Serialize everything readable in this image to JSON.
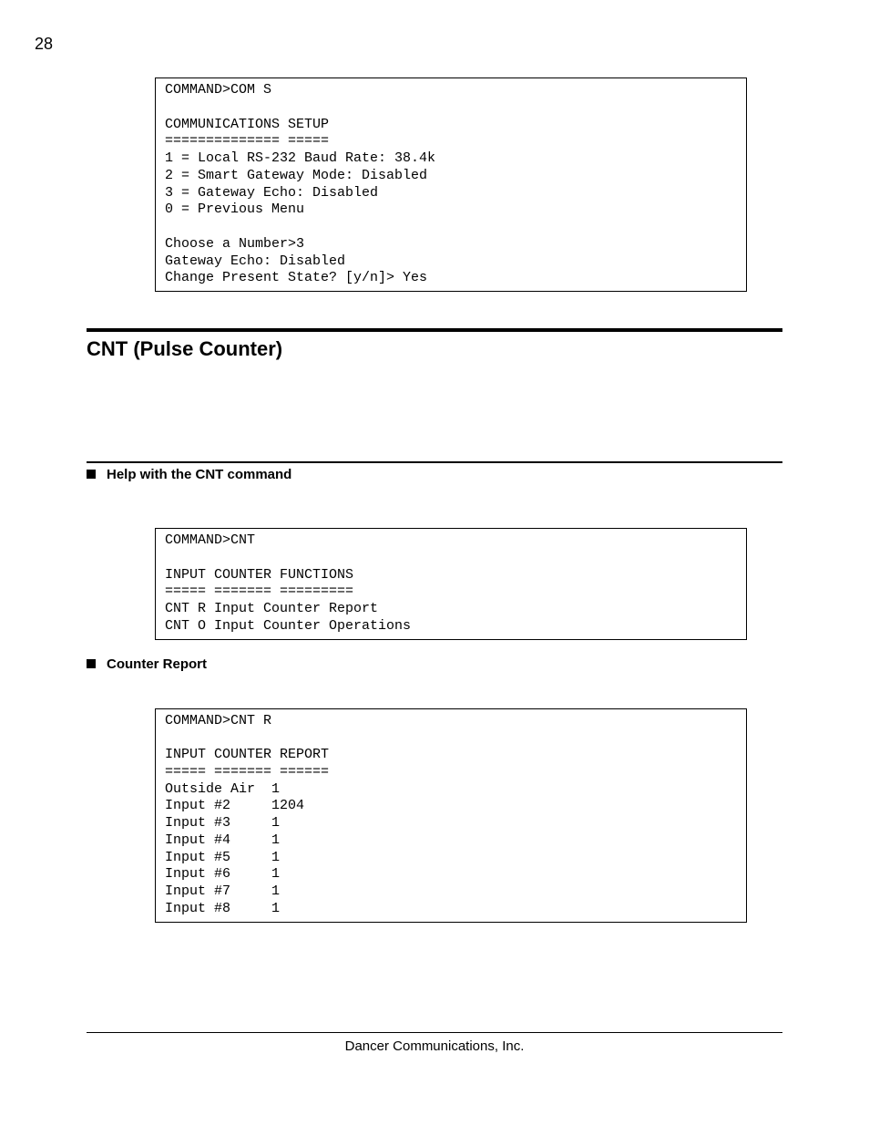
{
  "pageNumber": "28",
  "codeBox1": "COMMAND>COM S\n\nCOMMUNICATIONS SETUP\n============== =====\n1 = Local RS-232 Baud Rate: 38.4k\n2 = Smart Gateway Mode: Disabled\n3 = Gateway Echo: Disabled\n0 = Previous Menu\n\nChoose a Number>3\nGateway Echo: Disabled\nChange Present State? [y/n]> Yes",
  "sectionTitle": "CNT (Pulse Counter)",
  "subhead1": "Help with the CNT command",
  "codeBox2": "COMMAND>CNT\n\nINPUT COUNTER FUNCTIONS\n===== ======= =========\nCNT R Input Counter Report\nCNT O Input Counter Operations",
  "subhead2": "Counter Report",
  "codeBox3": "COMMAND>CNT R\n\nINPUT COUNTER REPORT\n===== ======= ======\nOutside Air  1\nInput #2     1204\nInput #3     1\nInput #4     1\nInput #5     1\nInput #6     1\nInput #7     1\nInput #8     1",
  "footer": "Dancer Communications, Inc."
}
